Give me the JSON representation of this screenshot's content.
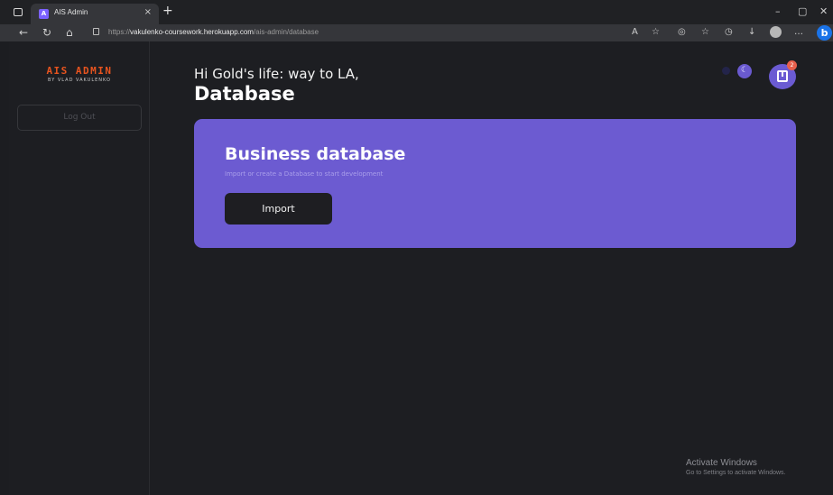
{
  "browser": {
    "tab_title": "AIS Admin",
    "tab_favicon_letter": "A",
    "url_prefix": "https://",
    "url_host": "vakulenko-coursework.herokuapp.com",
    "url_path": "/ais-admin/database",
    "new_tab_glyph": "+",
    "close_tab_glyph": "×",
    "window_controls": {
      "minimize": "–",
      "restore": "▢",
      "close": "✕"
    },
    "toolbar_icons": [
      "read-aloud-icon",
      "add-favorite-icon",
      "extensions-icon",
      "favorites-icon",
      "history-icon",
      "downloads-icon",
      "profile-icon",
      "more-icon",
      "bing-icon"
    ]
  },
  "sidebar": {
    "logo_main": "AIS ADMIN",
    "logo_sub": "BY VLAD VAKULENKO",
    "logout_label": "Log Out"
  },
  "header": {
    "greeting": "Hi Gold's life: way to LA,",
    "title": "Database",
    "notification_count": "2"
  },
  "card": {
    "title": "Business database",
    "subtitle": "Import or create a Database to start development",
    "import_label": "Import"
  },
  "watermark": {
    "title": "Activate Windows",
    "subtitle": "Go to Settings to activate Windows."
  },
  "colors": {
    "accent": "#6c5bd1",
    "logo": "#e8541f",
    "background": "#1d1e22"
  }
}
